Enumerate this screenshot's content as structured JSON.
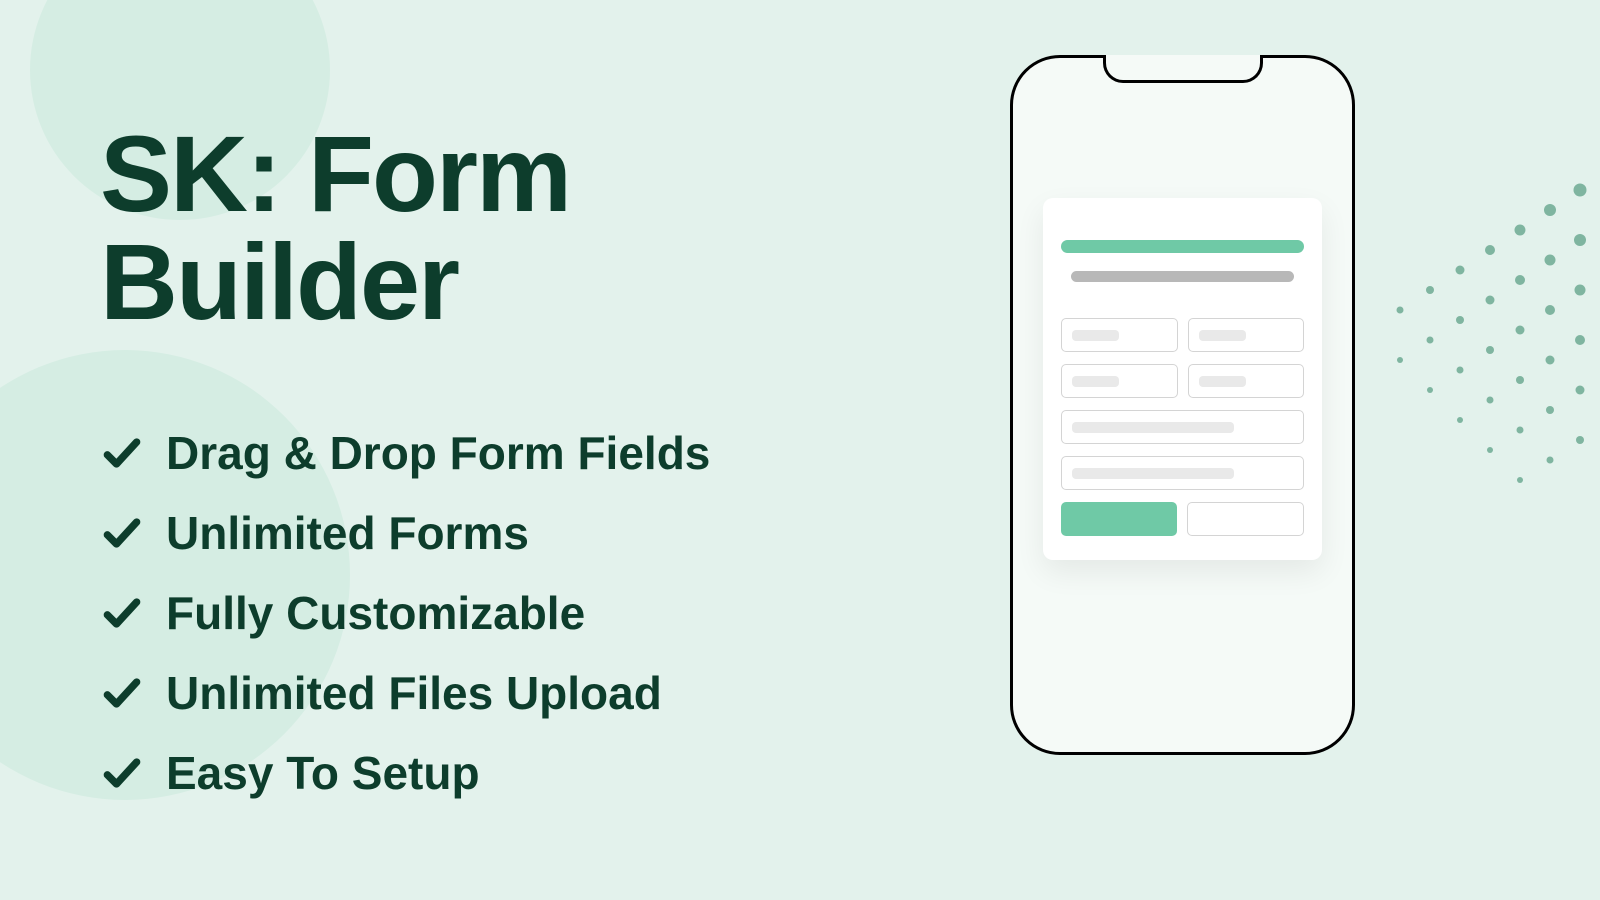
{
  "title": "SK: Form Builder",
  "features": [
    "Drag & Drop Form Fields",
    "Unlimited Forms",
    "Fully Customizable",
    "Unlimited Files Upload",
    "Easy To Setup"
  ],
  "colors": {
    "brand_dark": "#0d3d2c",
    "accent": "#6fc9a6",
    "background": "#e3f2ec"
  }
}
